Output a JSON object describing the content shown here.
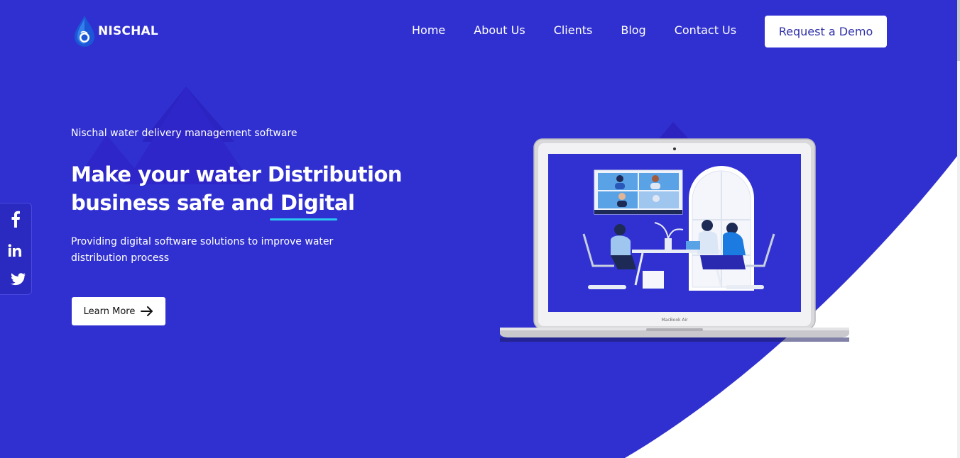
{
  "brand": {
    "name": "NISCHAL"
  },
  "nav": {
    "items": [
      {
        "label": "Home"
      },
      {
        "label": "About Us"
      },
      {
        "label": "Clients"
      },
      {
        "label": "Blog"
      },
      {
        "label": "Contact Us"
      }
    ],
    "cta_label": "Request a Demo"
  },
  "hero": {
    "eyebrow": "Nischal water delivery management software",
    "headline_line1": "Make your water Distribution",
    "headline_line2_start": "business safe and ",
    "headline_line2_highlight": "Digital",
    "subtext": "Providing digital software solutions to improve water distribution process",
    "learn_more_label": "Learn More",
    "laptop_model": "MacBook Air"
  },
  "social": {
    "items": [
      {
        "icon": "facebook-icon"
      },
      {
        "icon": "linkedin-icon"
      },
      {
        "icon": "twitter-icon"
      }
    ]
  },
  "colors": {
    "primary": "#3030d0",
    "accent": "#29c6f0",
    "white": "#ffffff",
    "button_text": "#3030a8"
  }
}
